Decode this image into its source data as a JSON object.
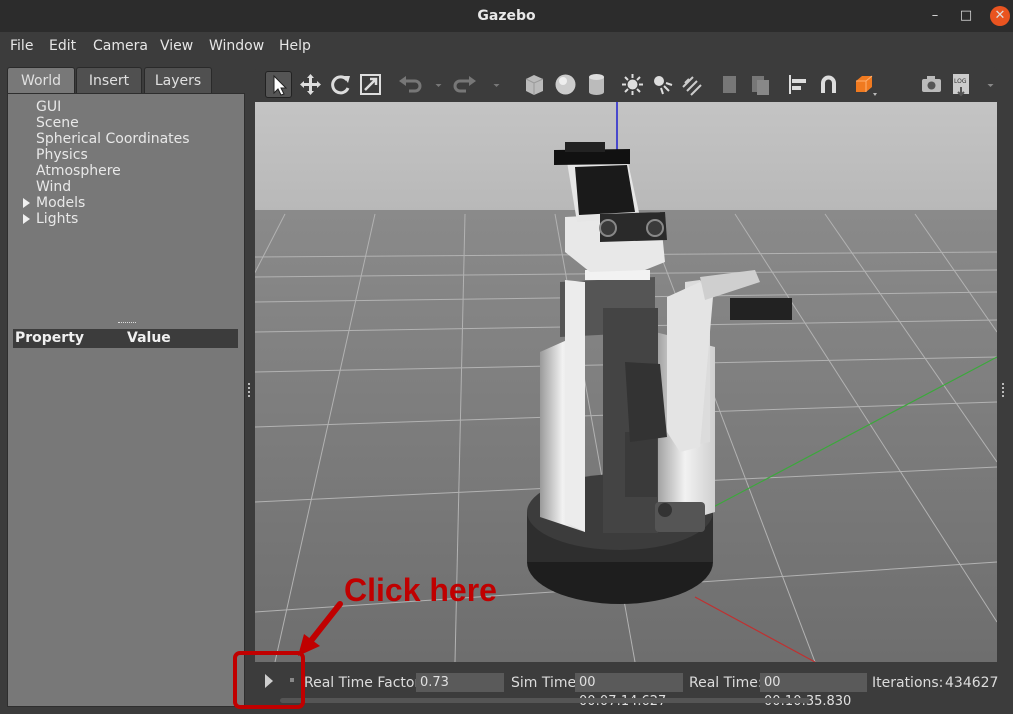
{
  "window": {
    "title": "Gazebo",
    "minimize": "–",
    "maximize": "□",
    "close": "✕"
  },
  "menubar": [
    {
      "label": "File"
    },
    {
      "label": "Edit"
    },
    {
      "label": "Camera"
    },
    {
      "label": "View"
    },
    {
      "label": "Window"
    },
    {
      "label": "Help"
    }
  ],
  "left_panel": {
    "tabs": [
      "World",
      "Insert",
      "Layers"
    ],
    "active_tab": "World",
    "tree": [
      "GUI",
      "Scene",
      "Spherical Coordinates",
      "Physics",
      "Atmosphere",
      "Wind",
      "Models",
      "Lights"
    ],
    "property_header": {
      "col1": "Property",
      "col2": "Value"
    }
  },
  "toolbar": {
    "icons": [
      "select-arrow-icon",
      "translate-icon",
      "rotate-icon",
      "scale-icon",
      "undo-icon",
      "undo-dropdown-icon",
      "redo-icon",
      "redo-dropdown-icon",
      "box-icon",
      "sphere-icon",
      "cylinder-icon",
      "point-light-icon",
      "spot-light-icon",
      "directional-light-icon",
      "copy-icon",
      "paste-icon",
      "align-icon",
      "snap-icon",
      "view-angle-icon",
      "screenshot-icon",
      "log-icon"
    ]
  },
  "bottom_bar": {
    "real_time_factor_label": "Real Time Factor:",
    "real_time_factor": "0.73",
    "sim_time_label": "Sim Time:",
    "sim_time": "00 00:07:14.627",
    "real_time_label": "Real Time:",
    "real_time": "00 00:10:35.830",
    "iterations_label": "Iterations:",
    "iterations": "434627"
  },
  "annotation": {
    "text": "Click here",
    "color": "#c00000"
  },
  "colors": {
    "accent": "#e95420",
    "panel": "#787878",
    "dark": "#3c3c3c"
  }
}
